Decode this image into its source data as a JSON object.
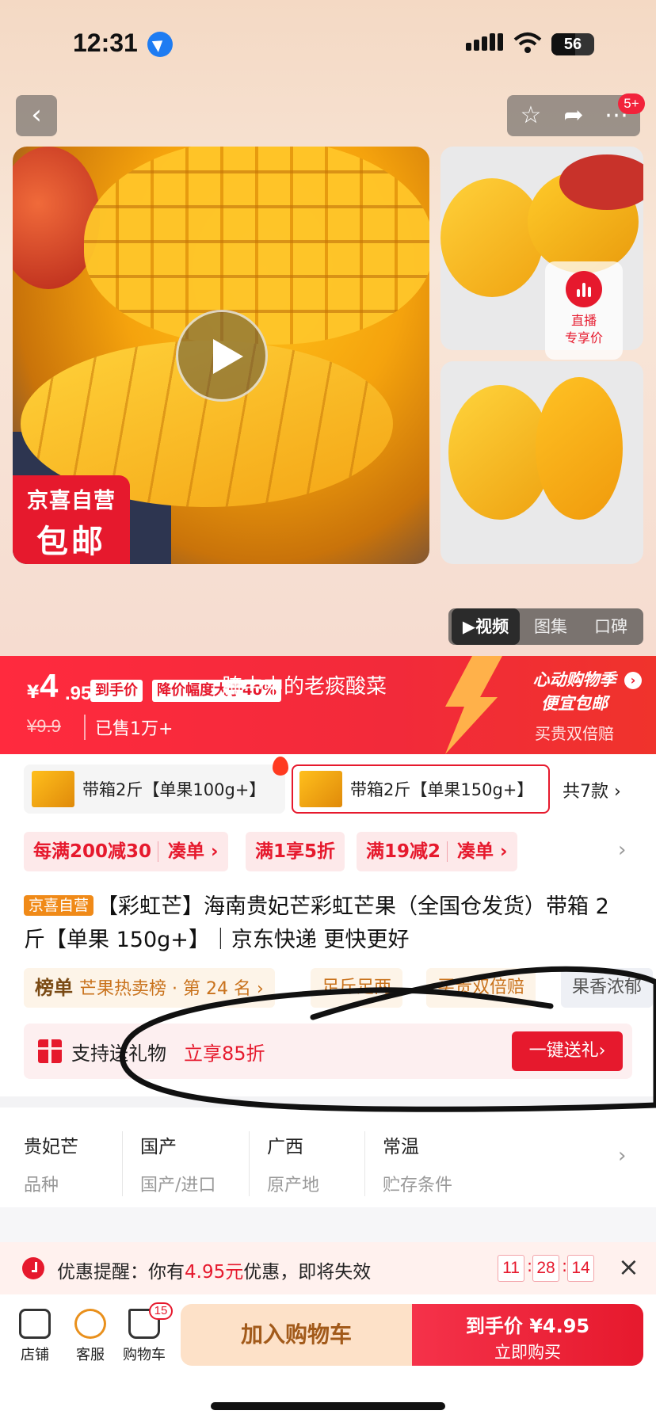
{
  "status_bar": {
    "time": "12:31",
    "battery": "56",
    "battery_level": 0.56
  },
  "nav": {
    "back_icon": "chevron-left-icon",
    "actions": [
      "star-icon",
      "share-icon",
      "more-icon"
    ],
    "more_badge": "5+"
  },
  "gallery": {
    "main_tag_line1": "京喜自营",
    "main_tag_line2": "包邮",
    "live_label1": "直播",
    "live_label2": "专享价",
    "tabs": [
      "▶视频",
      "图集",
      "口碑"
    ],
    "active_tab": 0
  },
  "price_bar": {
    "currency": "¥",
    "price_int": "4",
    "price_dec": ".95",
    "chip_final": "到手价",
    "chip_drop": "降价幅度大于40%",
    "overlay_text": "腌中中的老痰酸菜",
    "old_price": "¥9.9",
    "sold": "已售1万+",
    "promo_line1": "心动购物季",
    "promo_line2": "便宜包邮",
    "promo_line3": "买贵双倍赔",
    "accent": "#e6192d"
  },
  "variants": {
    "items": [
      {
        "label": "带箱2斤【单果100g+】",
        "selected": false
      },
      {
        "label": "带箱2斤【单果150g+】",
        "selected": true
      }
    ],
    "more": "共7款 ›"
  },
  "coupons": [
    {
      "main": "每满200减30",
      "sub": "凑单 ›"
    },
    {
      "main": "满1享5折",
      "sub": ""
    },
    {
      "main": "满19减2",
      "sub": "凑单 ›"
    }
  ],
  "title": {
    "tag": "京喜自营",
    "text": "【彩虹芒】海南贵妃芒彩虹芒果（全国仓发货）带箱 2 斤【单果 150g+】｜京东快递 更快更好"
  },
  "tags": [
    {
      "bold": "榜单",
      "text": "芒果热卖榜 · 第 24 名 ›"
    },
    {
      "bold": "",
      "text": "足斤足两"
    },
    {
      "bold": "",
      "text": "买贵双倍赔"
    },
    {
      "bold": "",
      "text": "果香浓郁"
    }
  ],
  "gift": {
    "label": "支持送礼物",
    "discount": "立享85折",
    "button": "一键送礼›"
  },
  "attributes": [
    {
      "value": "贵妃芒",
      "key": "品种"
    },
    {
      "value": "国产",
      "key": "国产/进口"
    },
    {
      "value": "广西",
      "key": "原产地"
    },
    {
      "value": "常温",
      "key": "贮存条件"
    }
  ],
  "reminder": {
    "prefix": "优惠提醒：你有",
    "amount": "4.95元",
    "suffix": "优惠，即将失效",
    "hh": "11",
    "mm": "28",
    "ss": "14"
  },
  "bottom_bar": {
    "store": "店铺",
    "service": "客服",
    "cart": "购物车",
    "cart_count": "15",
    "add_cart": "加入购物车",
    "buy_line1": "到手价 ¥4.95",
    "buy_line2": "立即购买"
  }
}
